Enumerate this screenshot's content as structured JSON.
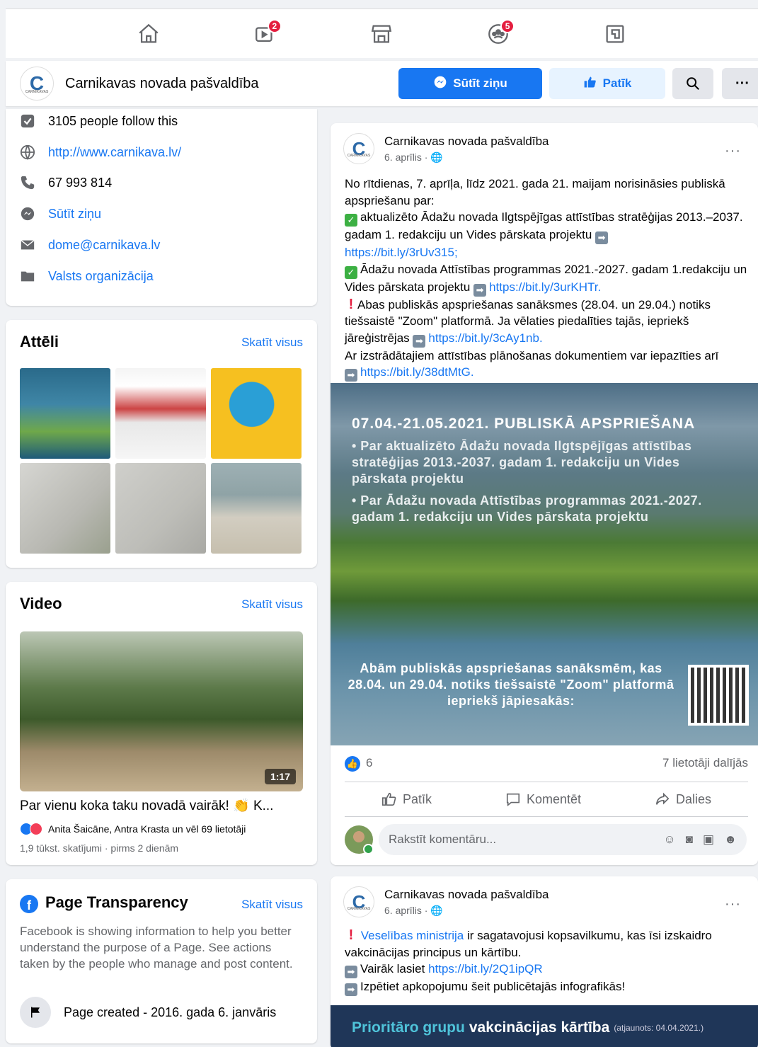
{
  "nav": {
    "video_badge": "2",
    "groups_badge": "5"
  },
  "page": {
    "name": "Carnikavas novada pašvaldība",
    "logo_letter": "C",
    "logo_sub": "CARNIKAVAS",
    "send_message": "Sūtīt ziņu",
    "like": "Patīk",
    "more": "···"
  },
  "about": {
    "followers": "3105 people follow this",
    "website": "http://www.carnikava.lv/",
    "phone": "67 993 814",
    "messenger": "Sūtīt ziņu",
    "email": "dome@carnikava.lv",
    "category": "Valsts organizācija"
  },
  "photos": {
    "title": "Attēli",
    "see_all": "Skatīt visus"
  },
  "videos": {
    "title": "Video",
    "see_all": "Skatīt visus",
    "duration": "1:17",
    "video_title": "Par vienu koka taku novadā vairāk! 👏 K...",
    "reactions": "Anita Šaicāne, Antra Krasta un vēl 69 lietotāji",
    "meta": "1,9 tūkst. skatījumi · pirms 2 dienām"
  },
  "transparency": {
    "title": "Page Transparency",
    "see_all": "Skatīt visus",
    "text": "Facebook is showing information to help you better understand the purpose of a Page. See actions taken by the people who manage and post content.",
    "created": "Page created - 2016. gada 6. janvāris"
  },
  "post1": {
    "author": "Carnikavas novada pašvaldība",
    "date": "6. aprīlis · 🌐",
    "line1": "No rītdienas, 7. aprīļa, līdz 2021. gada 21. maijam norisināsies publiskā apspriešanu par:",
    "line2": "aktualizēto Ādažu novada Ilgtspējīgas attīstības stratēģijas 2013.–2037. gadam 1. redakciju un Vides pārskata projektu",
    "link1": "https://bit.ly/3rUv315;",
    "line3": "Ādažu novada Attīstības programmas 2021.-2027. gadam 1.redakciju un Vides pārskata projektu",
    "link2": "https://bit.ly/3urKHTr.",
    "line4": "Abas publiskās apspriešanas sanāksmes (28.04. un 29.04.) notiks tiešsaistē \"Zoom\" platformā. Ja vēlaties piedalīties tajās, iepriekš jāreģistrējas",
    "link3": "https://bit.ly/3cAy1nb.",
    "line5": "Ar izstrādātajiem attīstības plānošanas dokumentiem var iepazīties arī",
    "link4": "https://bit.ly/38dtMtG.",
    "img_head": "07.04.-21.05.2021. PUBLISKĀ APSPRIEŠANA",
    "img_b1": "• Par aktualizēto Ādažu novada Ilgtspējīgas attīstības stratēģijas 2013.-2037. gadam 1. redakciju un Vides pārskata projektu",
    "img_b2": "• Par Ādažu novada Attīstības programmas 2021.-2027. gadam 1. redakciju un Vides pārskata projektu",
    "img_foot": "Abām publiskās apspriešanas sanāksmēm, kas 28.04. un 29.04. notiks tiešsaistē \"Zoom\" platformā iepriekš jāpiesakās:",
    "likes": "6",
    "shares": "7 lietotāji dalījās",
    "like": "Patīk",
    "comment": "Komentēt",
    "share": "Dalies",
    "comment_placeholder": "Rakstīt komentāru..."
  },
  "post2": {
    "author": "Carnikavas novada pašvaldība",
    "date": "6. aprīlis · 🌐",
    "link_ministry": "Veselības ministrija",
    "line1": "ir sagatavojusi kopsavilkumu, kas īsi izskaidro vakcinācijas principus un kārtību.",
    "line2": "Vairāk lasiet",
    "link1": "https://bit.ly/2Q1ipQR",
    "line3": "Izpētiet apkopojumu šeit publicētajās infografikās!",
    "banner_a": "Prioritāro grupu",
    "banner_b": "vakcinācijas kārtība",
    "banner_c": "(atjaunots: 04.04.2021.)"
  }
}
